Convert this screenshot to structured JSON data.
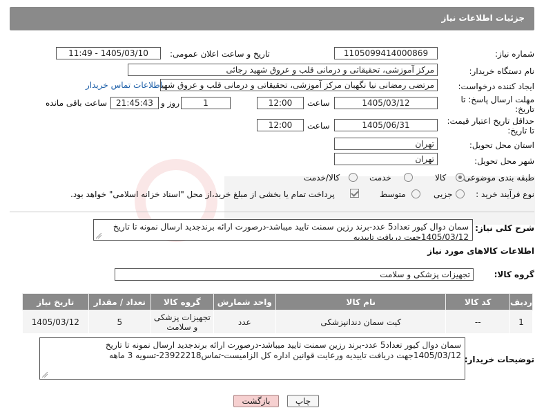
{
  "header": {
    "title": "جزئیات اطلاعات نیاز"
  },
  "fields": {
    "need_number_label": "شماره نیاز:",
    "need_number": "1105099414000869",
    "announce_label": "تاریخ و ساعت اعلان عمومی:",
    "announce_value": "1405/03/10 - 11:49",
    "buyer_label": "نام دستگاه خریدار:",
    "buyer_value": "مرکز آموزشی، تحقیقاتی و درمانی قلب و عروق شهید رجائی",
    "creator_label": "ایجاد کننده درخواست:",
    "creator_value": "مرتضی رمضانی نیا نگهبان مرکز آموزشی، تحقیقاتی و درمانی قلب و عروق شهید",
    "contact_link": "اطلاعات تماس خریدار",
    "deadline_label_1": "مهلت ارسال پاسخ: تا",
    "deadline_label_2": "تاریخ:",
    "deadline_date": "1405/03/12",
    "time_label": "ساعت",
    "deadline_time": "12:00",
    "days_value": "1",
    "days_label": "روز و",
    "remaining_value": "21:45:43",
    "remaining_label": "ساعت باقی مانده",
    "price_label_1": "حداقل تاریخ اعتبار قیمت:",
    "price_label_2": "تا تاریخ:",
    "price_date": "1405/06/31",
    "price_time": "12:00",
    "province_label": "استان محل تحویل:",
    "province_value": "تهران",
    "city_label": "شهر محل تحویل:",
    "city_value": "تهران",
    "category_label": "طبقه بندی موضوعی:",
    "category_options": [
      "کالا",
      "خدمت",
      "کالا/خدمت"
    ],
    "category_selected": "کالا",
    "process_label": "نوع فرآیند خرید :",
    "process_options": [
      "جزیی",
      "متوسط"
    ],
    "payment_note": "پرداخت تمام یا بخشی از مبلغ خرید،از محل \"اسناد خزانه اسلامی\" خواهد بود."
  },
  "description": {
    "label": "شرح کلی نیاز:",
    "text": "سمان دوال کیور تعداد5 عدد-برند رزین سمنت تایید میباشد-درصورت ارائه برندجدید ارسال نمونه تا تاریخ 1405/03/12جهت دریافت تاییدیه"
  },
  "goods": {
    "section_title": "اطلاعات کالاهای مورد نیاز",
    "group_label": "گروه کالا:",
    "group_value": "تجهیزات پزشکی و سلامت",
    "columns": [
      "ردیف",
      "کد کالا",
      "نام کالا",
      "واحد شمارش",
      "گروه کالا",
      "تعداد / مقدار",
      "تاریخ نیاز"
    ],
    "rows": [
      [
        "1",
        "--",
        "کیت سمان دندانپزشکی",
        "عدد",
        "تجهیزات پزشکی و سلامت",
        "5",
        "1405/03/12"
      ]
    ]
  },
  "buyer_notes": {
    "label": "توضیحات خریدار:",
    "text": "سمان دوال کیور تعداد5 عدد-برند رزین سمنت تایید میباشد-درصورت ارائه برندجدید ارسال نمونه تا تاریخ 1405/03/12جهت دریافت تاییدیه ورعایت قوانین اداره کل الزامیست-تماس23922218-تسویه 3 ماهه"
  },
  "buttons": {
    "print": "چاپ",
    "back": "بازگشت"
  },
  "colors": {
    "header_bg": "#8a8a8a",
    "link": "#1d5fa8",
    "back_button": "#f6d0d0"
  }
}
